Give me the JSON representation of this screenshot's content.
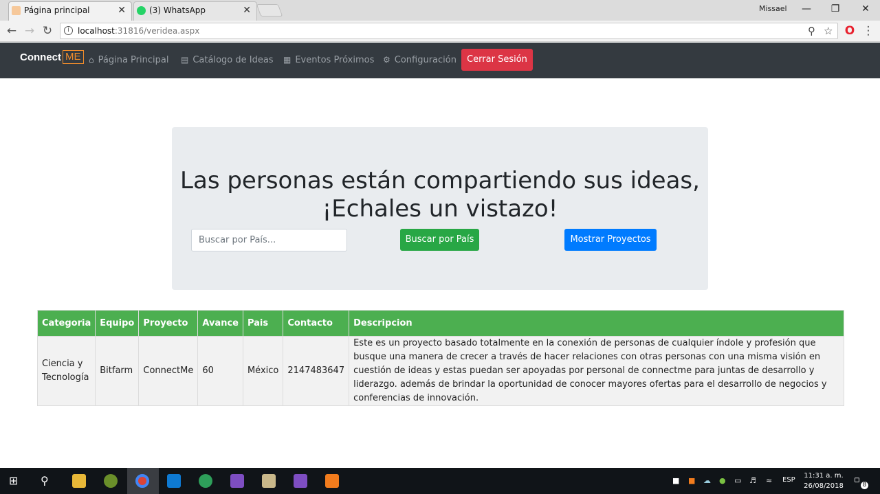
{
  "browser": {
    "tabs": [
      {
        "title": "Página principal",
        "active": true
      },
      {
        "title": "(3) WhatsApp",
        "active": false
      }
    ],
    "close_glyph": "✕",
    "user_name": "Missael",
    "window_buttons": {
      "minimize": "—",
      "restore": "❐",
      "close": "✕"
    },
    "url_host": "localhost",
    "url_path": ":31816/veridea.aspx",
    "info_glyph": "i",
    "icons": [
      "back-icon",
      "forward-icon",
      "reload-icon",
      "zoom-icon",
      "star-icon",
      "opera-icon",
      "menu-icon"
    ]
  },
  "navbar": {
    "brand_text": "Connect",
    "brand_badge": "ME",
    "links": [
      {
        "label": "Página Principal",
        "icon": "home-icon"
      },
      {
        "label": "Catálogo de Ideas",
        "icon": "book-icon"
      },
      {
        "label": "Eventos Próximos",
        "icon": "table-icon"
      },
      {
        "label": "Configuración",
        "icon": "gear-icon"
      }
    ],
    "logout_label": "Cerrar Sesión"
  },
  "hero": {
    "title_line1": "Las personas están compartiendo sus ideas,",
    "title_line2": "¡Echales un vistazo!",
    "search_placeholder": "Buscar por País...",
    "search_button": "Buscar por País",
    "show_button": "Mostrar Proyectos"
  },
  "table": {
    "headers": [
      "Categoria",
      "Equipo",
      "Proyecto",
      "Avance",
      "Pais",
      "Contacto",
      "Descripcion"
    ],
    "rows": [
      {
        "categoria": "Ciencia y Tecnología",
        "equipo": "Bitfarm",
        "proyecto": "ConnectMe",
        "avance": "60",
        "pais": "México",
        "contacto": "2147483647",
        "descripcion": "Este es un proyecto basado totalmente en la conexión de personas de cualquier índole y profesión que busque una manera de crecer a través de hacer relaciones con otras personas con una misma visión en cuestión de ideas y estas puedan ser apoyadas por personal de connectme para juntas de desarrollo y liderazgo. además de brindar la oportunidad de conocer mayores ofertas para el desarrollo de negocios y conferencias de innovación."
      }
    ]
  },
  "taskbar": {
    "language": "ESP",
    "time": "11:31 a. m.",
    "date": "26/08/2018",
    "notifications": "8",
    "colors": {
      "background": "#101418",
      "accent": "#28a745"
    }
  }
}
